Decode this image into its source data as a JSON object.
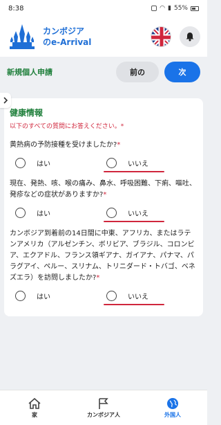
{
  "status_bar": {
    "time": "8:38",
    "battery": "55%"
  },
  "header": {
    "title_line1": "カンボジア",
    "title_line2": "のe-Arrival"
  },
  "subheader": {
    "label": "新規個人申請",
    "prev_label": "前の",
    "next_label": "次"
  },
  "form": {
    "title": "健康情報",
    "instruction": "以下のすべての質問にお答えください。",
    "required_mark": "*",
    "questions": [
      {
        "text": "黄熱病の予防接種を受けましたか?",
        "yes": "はい",
        "no": "いいえ"
      },
      {
        "text": "現在、発熱、咳、喉の痛み、鼻水、呼吸困難、下痢、嘔吐、発疹などの症状がありますか?",
        "yes": "はい",
        "no": "いいえ"
      },
      {
        "text": "カンボジア到着前の14日間に中東、アフリカ、またはラテンアメリカ（アルゼンチン、ボリビア、ブラジル、コロンビア、エクアドル、フランス領ギアナ、ガイアナ、パナマ、パラグアイ、ペルー、スリナム、トリニダード・トバゴ、ベネズエラ）を訪問しましたか?",
        "yes": "はい",
        "no": "いいえ"
      }
    ]
  },
  "bottom_nav": [
    {
      "label": "家",
      "icon": "home-icon"
    },
    {
      "label": "カンボジア人",
      "icon": "flag-icon"
    },
    {
      "label": "外国人",
      "icon": "globe-icon",
      "active": true
    }
  ],
  "colors": {
    "accent": "#1a73e8",
    "section_green": "#1f7f3b",
    "required_red": "#d0263c"
  }
}
